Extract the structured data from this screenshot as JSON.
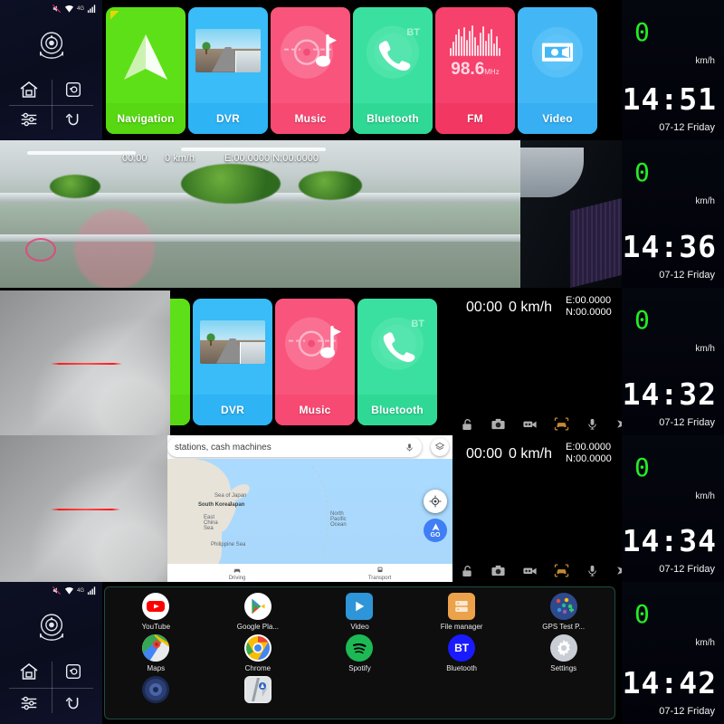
{
  "device": {
    "status_icons": [
      "mute-icon",
      "wifi-icon",
      "4g-label",
      "signal-bars-icon"
    ],
    "network_label": "4G"
  },
  "nav_panel": {
    "main_icon": "dashcam-icon",
    "buttons": [
      {
        "name": "home",
        "icon": "home-icon"
      },
      {
        "name": "screenshot",
        "icon": "screen-capture-icon"
      },
      {
        "name": "settings",
        "icon": "sliders-icon"
      },
      {
        "name": "back",
        "icon": "back-arrow-icon"
      }
    ]
  },
  "tiles": [
    {
      "id": "navigation",
      "label": "Navigation",
      "icon": "compass-triangle-icon",
      "color": "#5de017"
    },
    {
      "id": "dvr",
      "label": "DVR",
      "icon": "road-photo-icon",
      "color": "#39bcf7"
    },
    {
      "id": "music",
      "label": "Music",
      "icon": "vinyl-note-icon",
      "color": "#f9557c"
    },
    {
      "id": "bluetooth",
      "label": "Bluetooth",
      "icon": "phone-bt-icon",
      "color": "#3ae0a0",
      "badge": "BT"
    },
    {
      "id": "fm",
      "label": "FM",
      "icon": "waveform-icon",
      "color": "#f6416c",
      "frequency": "98.6",
      "frequency_unit": "MHz"
    },
    {
      "id": "video",
      "label": "Video",
      "icon": "film-camera-icon",
      "color": "#43b7f5"
    }
  ],
  "cluster": {
    "speed": "0",
    "speed_unit": "km/h",
    "date": "07-12  Friday",
    "speed_color": "#22ee22",
    "rows": [
      {
        "time": "14:51"
      },
      {
        "time": "14:36"
      },
      {
        "time": "14:32"
      },
      {
        "time": "14:34"
      },
      {
        "time": "14:42"
      }
    ]
  },
  "dvr_osd": {
    "timer": "00:00",
    "speed": "0 km/h",
    "lat": "E:00.0000",
    "lon": "N:00.0000",
    "combined_gps": "E:00.0000 N:00.0000"
  },
  "dvr_toolbar": [
    {
      "name": "lock",
      "icon": "unlocked-padlock-icon"
    },
    {
      "name": "photo",
      "icon": "camera-icon"
    },
    {
      "name": "record",
      "icon": "video-camera-icon"
    },
    {
      "name": "parking-monitor",
      "icon": "car-frame-icon"
    },
    {
      "name": "mic",
      "icon": "microphone-icon"
    },
    {
      "name": "playback",
      "icon": "play-arrow-icon"
    }
  ],
  "map": {
    "search_text": "stations, cash machines",
    "mic_icon": "microphone-icon",
    "layers_icon": "map-layers-icon",
    "locate_icon": "my-location-icon",
    "go_label": "GO",
    "labels": [
      {
        "text": "South Korea",
        "bold": true
      },
      {
        "text": "Japan",
        "bold": true
      },
      {
        "text": "Sea of Japan",
        "bold": false
      },
      {
        "text": "East China Sea",
        "bold": false
      },
      {
        "text": "North Pacific Ocean",
        "bold": false
      },
      {
        "text": "Philippine Sea",
        "bold": false
      }
    ],
    "tabs": [
      {
        "label": "Driving",
        "icon": "car-icon"
      },
      {
        "label": "Transport",
        "icon": "train-icon"
      }
    ]
  },
  "app_drawer": {
    "apps": [
      {
        "label": "YouTube",
        "icon": "youtube-icon"
      },
      {
        "label": "Google Pla...",
        "icon": "play-store-icon"
      },
      {
        "label": "Video",
        "icon": "video-player-icon"
      },
      {
        "label": "File manager",
        "icon": "file-manager-icon"
      },
      {
        "label": "GPS Test P...",
        "icon": "gps-test-icon"
      },
      {
        "label": "Maps",
        "icon": "google-maps-icon"
      },
      {
        "label": "Chrome",
        "icon": "chrome-icon"
      },
      {
        "label": "Spotify",
        "icon": "spotify-icon"
      },
      {
        "label": "Bluetooth",
        "icon": "bluetooth-icon"
      },
      {
        "label": "Settings",
        "icon": "gear-icon"
      },
      {
        "label": "",
        "icon": "sound-recorder-icon"
      },
      {
        "label": "",
        "icon": "navi-map-icon"
      }
    ]
  }
}
